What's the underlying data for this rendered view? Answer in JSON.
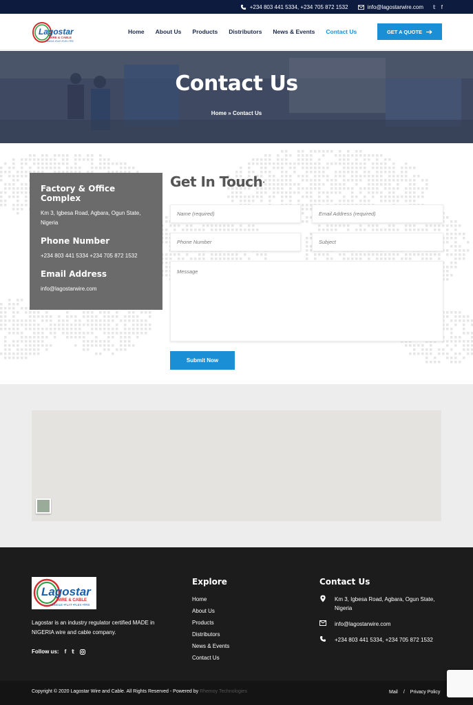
{
  "topbar": {
    "phone": "+234 803 441 5334, +234 705 872 1532",
    "email": "info@lagostarwire.com",
    "social_icons": [
      "twitter-icon",
      "facebook-icon"
    ]
  },
  "header": {
    "logo_text": "Lagostar",
    "logo_sub": "WIRE & CABLE",
    "logo_tag": "•SINGLE •FLAT •FLEX •TRS",
    "nav": [
      "Home",
      "About Us",
      "Products",
      "Distributors",
      "News & Events",
      "Contact Us"
    ],
    "active_nav": "Contact Us",
    "quote_button": "GET A QUOTE"
  },
  "hero": {
    "title": "Contact Us",
    "breadcrumb_home": "Home",
    "breadcrumb_sep": "»",
    "breadcrumb_current": "Contact Us"
  },
  "info": {
    "factory_title": "Factory & Office Complex",
    "factory_address": "Km 3, Igbesa Road, Agbara, Ogun State, Nigeria",
    "phone_title": "Phone Number",
    "phone_value": "+234 803 441 5334 +234 705 872 1532",
    "email_title": "Email Address",
    "email_value": "info@lagostarwire.com"
  },
  "form": {
    "title": "Get In Touch",
    "name_placeholder": "Name (required)",
    "email_placeholder": "Email Address (required)",
    "phone_placeholder": "Phone Number",
    "subject_placeholder": "Subject",
    "message_placeholder": "Message",
    "submit_label": "Submit Now"
  },
  "footer": {
    "description": "Lagostar is an industry regulator certified MADE in NIGERIA wire and cable company.",
    "follow_label": "Follow us:",
    "explore_title": "Explore",
    "explore_links": [
      "Home",
      "About Us",
      "Products",
      "Distributors",
      "News & Events",
      "Contact Us"
    ],
    "contact_title": "Contact Us",
    "contact_address": "Km 3, Igbesa Road, Agbara, Ogun State, Nigeria",
    "contact_email": "info@lagostarwire.com",
    "contact_phone": "+234 803 441 5334, +234 705 872 1532"
  },
  "bottom": {
    "copyright": "Copyright © 2020 Lagostar Wire and Cable. All Rights Reserved - Powered by",
    "powered_by": "Rhemoy Technologies",
    "link_mail": "Mail",
    "link_sep": "/",
    "link_privacy": "Privacy Policy"
  },
  "colors": {
    "topbar_bg": "#0d1b3e",
    "accent": "#1a8fd6",
    "info_box_bg": "#6b6b6b",
    "footer_bg": "#1c1c1c"
  }
}
